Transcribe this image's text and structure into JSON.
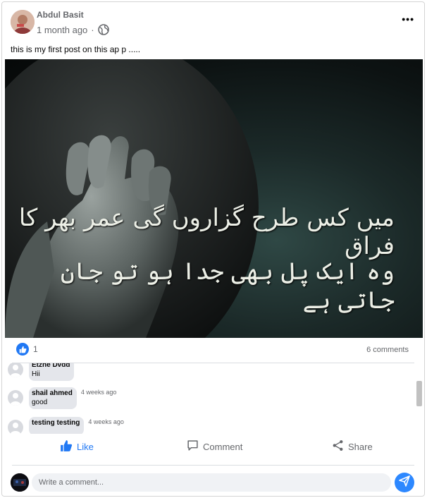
{
  "post": {
    "author": "Abdul Basit",
    "time": "1 month ago",
    "separator": "·",
    "text": "this is my first post on this ap p .....",
    "image_text": {
      "line1": "میں کس طرح گزاروں گی عمر بھر کا فراق",
      "line2": "وہ ایک پل بھی جدا ہو تو جان جاتی ہے"
    }
  },
  "stats": {
    "like_count": "1",
    "comments_count": "6 comments"
  },
  "comments": [
    {
      "name": "Etzhe Dvdd",
      "text": "Hii",
      "time": ""
    },
    {
      "name": "shail ahmed",
      "text": "good",
      "time": "4 weeks ago"
    },
    {
      "name": "testing testing",
      "text": "",
      "time": "4 weeks ago"
    }
  ],
  "actions": {
    "like": "Like",
    "comment": "Comment",
    "share": "Share"
  },
  "composer": {
    "placeholder": "Write a comment..."
  },
  "icons": {
    "more": "more-horizontal-icon",
    "privacy": "globe-icon",
    "like": "thumbs-up-icon",
    "comment": "comment-icon",
    "share": "share-icon",
    "send": "send-icon"
  },
  "colors": {
    "accent": "#2078f4",
    "send": "#2d88ff",
    "muted_text": "#65676b",
    "bubble": "#e4e6eb"
  }
}
